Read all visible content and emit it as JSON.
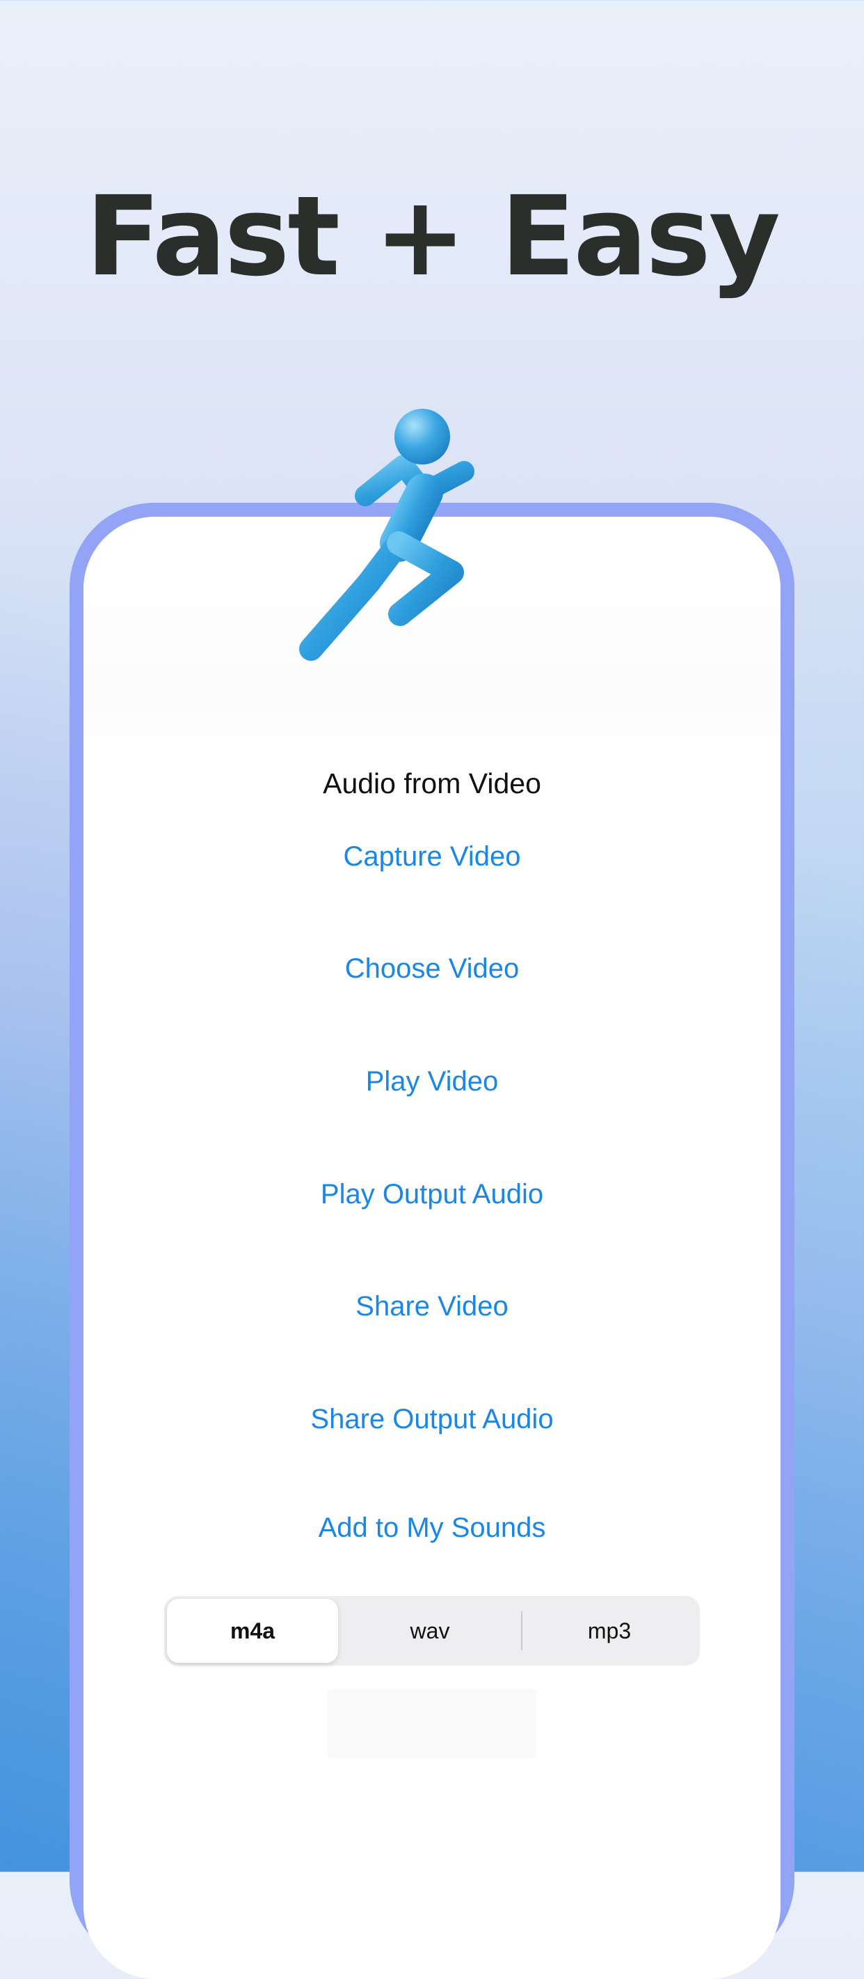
{
  "headline": "Fast + Easy",
  "icon": "running-person-icon",
  "screen": {
    "title": "Audio from Video",
    "actions": [
      "Capture Video",
      "Choose Video",
      "Play Video",
      "Play Output Audio",
      "Share Video",
      "Share Output Audio",
      "Add to My Sounds"
    ],
    "format_options": [
      "m4a",
      "wav",
      "mp3"
    ],
    "selected_format": "m4a"
  },
  "colors": {
    "accent": "#1a86e6",
    "frame": "#93a3f5",
    "headline": "#2a2f2b",
    "runner": "#3aa6e2"
  }
}
